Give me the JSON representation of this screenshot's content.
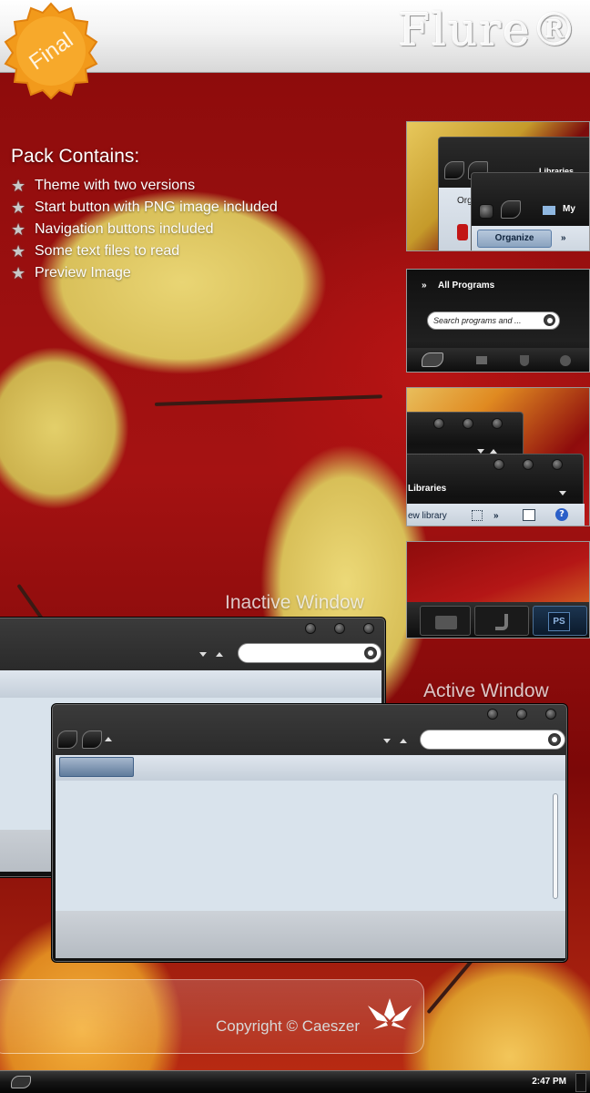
{
  "header": {
    "logo_text": "Flure®",
    "badge_text": "Final"
  },
  "pack": {
    "title": "Pack Contains:",
    "items": [
      "Theme with two versions",
      "Start button with PNG image included",
      "Navigation buttons included",
      "Some text files to read",
      "Preview Image"
    ]
  },
  "thumbs": {
    "explorer": {
      "libraries": "Libraries",
      "organize_partial": "Org",
      "my_partial": "My",
      "organize": "Organize",
      "more": "»"
    },
    "startmenu": {
      "all_programs": "All Programs",
      "search_placeholder": "Search programs and ...",
      "chevron": "»"
    },
    "libraries_win": {
      "libraries": "Libraries",
      "new_library": "ew library",
      "more": "»"
    },
    "taskbar_icons": {
      "ps": "PS"
    }
  },
  "windows": {
    "inactive_label": "Inactive Window",
    "active_label": "Active Window"
  },
  "footer": {
    "copyright": "Copyright © Caeszer"
  },
  "taskbar": {
    "clock": "2:47 PM"
  },
  "colors": {
    "header_bg": "#f3f3f3",
    "window_frame": "#1a1a1a",
    "window_body": "#d9e3ec",
    "background_red": "#8e0c0c",
    "leaf_yellow": "#e6cf6a",
    "seal_orange": "#f59a1e"
  }
}
